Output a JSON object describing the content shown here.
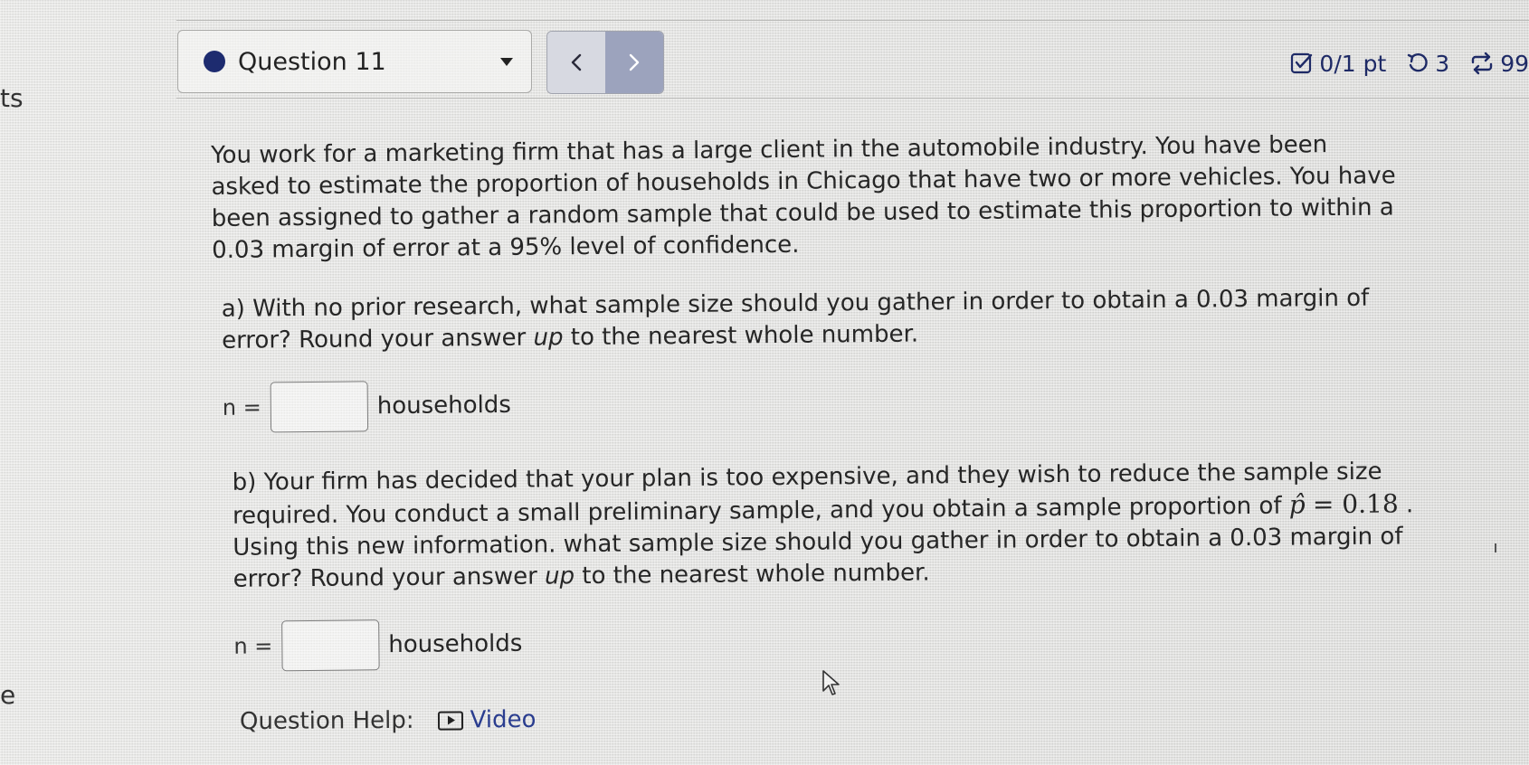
{
  "left_edge": {
    "top_fragment": "ts",
    "bottom_fragment": "e"
  },
  "header": {
    "question_selector": "Question 11",
    "status_dot_color": "#1d2b6f",
    "prev_icon": "chevron-left-icon",
    "next_icon": "chevron-right-icon",
    "score": "0/1 pt",
    "retries": "3",
    "attempts": "99",
    "icons": [
      "checkbox-icon",
      "retry-icon",
      "attempts-icon"
    ]
  },
  "question": {
    "prompt": "You work for a marketing firm that has a large client in the automobile industry. You have been asked to estimate the proportion of households in Chicago that have two or more vehicles.  You have been assigned to gather a random sample that could be used to estimate this proportion to within a 0.03 margin of error at a 95% level of confidence.",
    "part_a": {
      "label": "a)",
      "text_before": "With no prior research, what sample size should you gather in order to obtain a 0.03 margin of error? Round your answer ",
      "emphasis": "up",
      "text_after": " to the nearest whole number.",
      "n_label": "n =",
      "input_value": "",
      "unit": "households"
    },
    "part_b": {
      "label": "b)",
      "text_1": "Your firm has decided that your plan is too expensive, and they wish to reduce the sample size required. You conduct a small preliminary sample, and you obtain a sample proportion of ",
      "phat_symbol": "p̂",
      "equals_value": "= 0.18",
      "text_2": ". Using this new information. what sample size should you gather in order to obtain a 0.03 margin of error? Round your answer ",
      "emphasis": "up",
      "text_3": " to the nearest whole number.",
      "n_label": "n =",
      "input_value": "",
      "unit": "households"
    }
  },
  "help": {
    "label": "Question Help:",
    "video_label": "Video",
    "video_icon": "play-icon",
    "link_color": "#2a3d8f"
  }
}
